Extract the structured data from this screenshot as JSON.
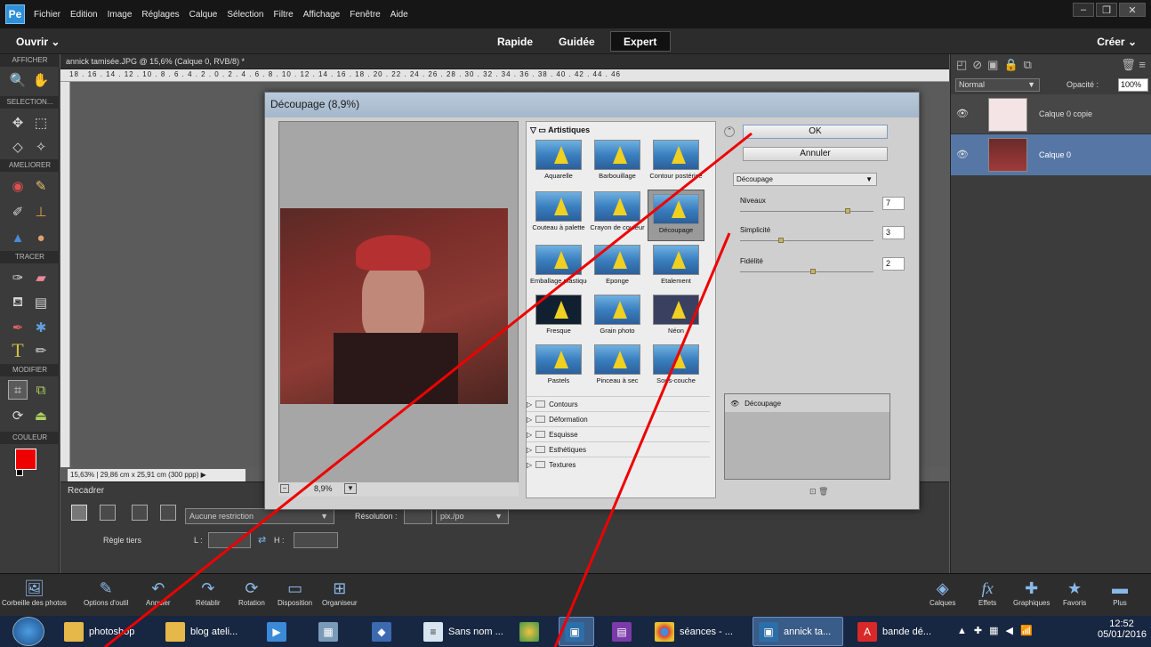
{
  "menubar": {
    "logo": "Pe",
    "items": [
      "Fichier",
      "Edition",
      "Image",
      "Réglages",
      "Calque",
      "Sélection",
      "Filtre",
      "Affichage",
      "Fenêtre",
      "Aide"
    ]
  },
  "modebar": {
    "open": "Ouvrir",
    "create": "Créer",
    "tabs": [
      "Rapide",
      "Guidée",
      "Expert"
    ],
    "active": "Expert"
  },
  "toolbox": {
    "sections": [
      "AFFICHER",
      "SELECTION...",
      "AMELIORER",
      "TRACER",
      "MODIFIER",
      "COULEUR"
    ]
  },
  "document": {
    "tab": "annick tamisée.JPG @ 15,6% (Calque 0, RVB/8) *",
    "ruler_ticks": "18 . 16 . 14 . 12 . 10 . 8 . 6 . 4 . 2 . 0 . 2 . 4 . 6 . 8 . 10 . 12 . 14 . 16 . 18 . 20 . 22 . 24 . 26 . 28 . 30 . 32 . 34 . 36 . 38 . 40 . 42 . 44 . 46",
    "zoom": "15,63%",
    "size": "29,86 cm x 25,91 cm (300 ppp)"
  },
  "options": {
    "title": "Recadrer",
    "grid_label": "Règle tiers",
    "restriction": "Aucune restriction",
    "resolution_label": "Résolution :",
    "unit": "pix./po",
    "l_label": "L :",
    "h_label": "H :"
  },
  "layers": {
    "blend": "Normal",
    "opacity_label": "Opacité :",
    "opacity": "100%",
    "items": [
      {
        "name": "Calque 0 copie"
      },
      {
        "name": "Calque 0"
      }
    ]
  },
  "dialog": {
    "title": "Découpage (8,9%)",
    "zoom": "8,9%",
    "category_open": "Artistiques",
    "filters": [
      "Aquarelle",
      "Barbouillage",
      "Contour postérisé",
      "Couteau à palette",
      "Crayon de couleur",
      "Découpage",
      "Emballage plastique",
      "Eponge",
      "Etalement",
      "Fresque",
      "Grain photo",
      "Néon",
      "Pastels",
      "Pinceau à sec",
      "Sous-couche"
    ],
    "categories": [
      "Contours",
      "Déformation",
      "Esquisse",
      "Esthétiques",
      "Textures"
    ],
    "ok": "OK",
    "cancel": "Annuler",
    "filter_select": "Découpage",
    "params": [
      {
        "label": "Niveaux",
        "value": "7",
        "level": 0.82
      },
      {
        "label": "Simplicité",
        "value": "3",
        "level": 0.3
      },
      {
        "label": "Fidélité",
        "value": "2",
        "level": 0.55
      }
    ],
    "effect_layer": "Découpage"
  },
  "panelbar": {
    "left": [
      "Corbeille des photos",
      "Options d'outil",
      "Annuler",
      "Rétablir",
      "Rotation",
      "Disposition",
      "Organiseur"
    ],
    "right": [
      "Calques",
      "Effets",
      "Graphiques",
      "Favoris",
      "Plus"
    ]
  },
  "taskbar": {
    "items": [
      "photoshop",
      "blog ateli...",
      "",
      "",
      "",
      "Sans nom ...",
      "",
      "",
      "",
      "séances - ...",
      "annick ta...",
      "bande dé..."
    ],
    "time": "12:52",
    "date": "05/01/2016"
  }
}
